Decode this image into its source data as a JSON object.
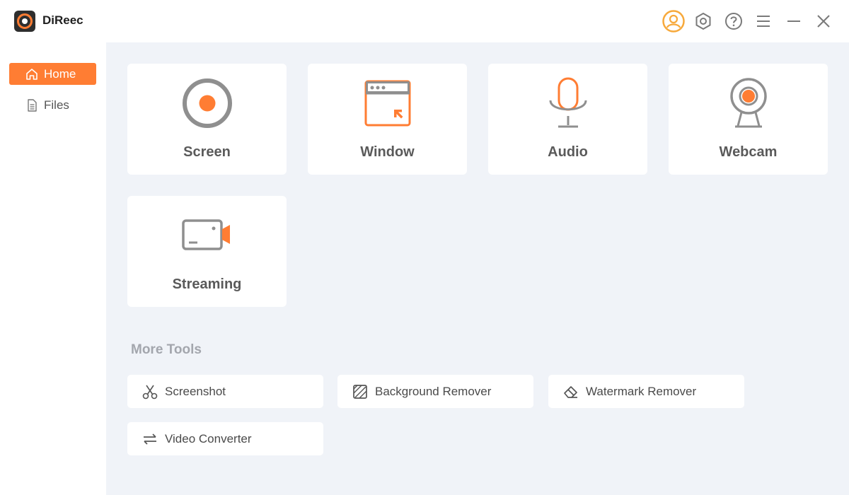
{
  "app": {
    "title": "DiReec"
  },
  "titlebar": {
    "icons": [
      "user-icon",
      "settings-icon",
      "help-icon",
      "menu-icon",
      "minimize-icon",
      "close-icon"
    ]
  },
  "sidebar": {
    "items": [
      {
        "label": "Home",
        "icon": "home-icon",
        "active": true
      },
      {
        "label": "Files",
        "icon": "file-icon",
        "active": false
      }
    ]
  },
  "cards": [
    {
      "label": "Screen",
      "icon": "screen-record-icon"
    },
    {
      "label": "Window",
      "icon": "window-record-icon"
    },
    {
      "label": "Audio",
      "icon": "microphone-icon"
    },
    {
      "label": "Webcam",
      "icon": "webcam-icon"
    },
    {
      "label": "Streaming",
      "icon": "streaming-icon"
    }
  ],
  "more_tools": {
    "title": "More Tools",
    "items": [
      {
        "label": "Screenshot",
        "icon": "scissors-icon"
      },
      {
        "label": "Background Remover",
        "icon": "background-remover-icon"
      },
      {
        "label": "Watermark Remover",
        "icon": "eraser-icon"
      },
      {
        "label": "Video Converter",
        "icon": "convert-arrows-icon"
      }
    ]
  },
  "colors": {
    "accent": "#ff7d33",
    "icon_gray": "#8f8f8f",
    "background": "#f0f3f8",
    "user_icon": "#f7a93b"
  }
}
